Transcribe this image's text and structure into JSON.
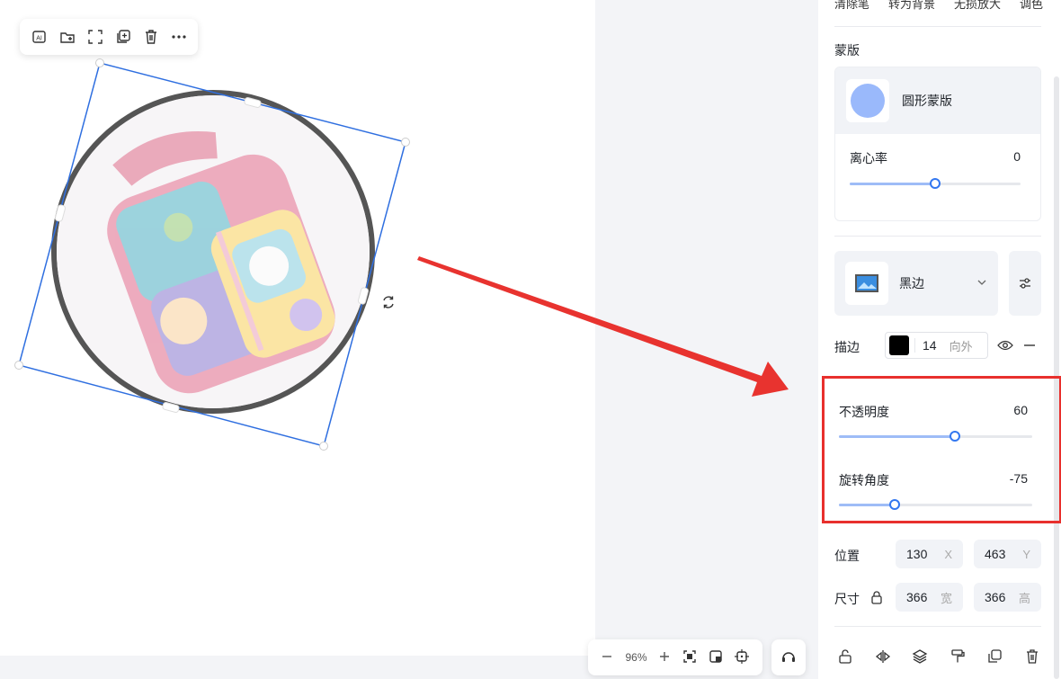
{
  "top_tabs": [
    "清除笔",
    "转为背景",
    "无损放大",
    "调色"
  ],
  "mask": {
    "section_title": "蒙版",
    "name": "圆形蒙版",
    "eccentricity_label": "离心率",
    "eccentricity_value": "0",
    "eccentricity_fraction": 0.5
  },
  "frame": {
    "name": "黑边"
  },
  "stroke": {
    "label": "描边",
    "color": "#000000",
    "width": "14",
    "position": "向外"
  },
  "opacity": {
    "label": "不透明度",
    "value": "60",
    "fraction": 0.6
  },
  "rotation": {
    "label": "旋转角度",
    "value": "-75",
    "fraction": 0.29
  },
  "position": {
    "label": "位置",
    "x": "130",
    "x_unit": "X",
    "y": "463",
    "y_unit": "Y"
  },
  "size": {
    "label": "尺寸",
    "w": "366",
    "w_unit": "宽",
    "h": "366",
    "h_unit": "高"
  },
  "zoom": {
    "value": "96%"
  },
  "colors": {
    "accent": "#3377f0",
    "highlight": "#e8302d",
    "selection": "#2f6fe0"
  }
}
